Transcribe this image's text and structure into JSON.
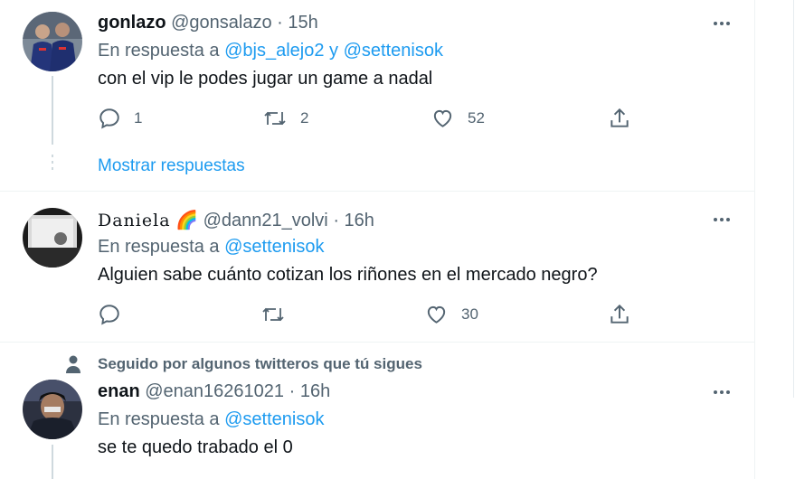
{
  "tweets": [
    {
      "display_name": "gonlazo",
      "handle": "@gonsalazo",
      "time": "15h",
      "reply_prefix": "En respuesta a",
      "mention1": "@bjs_alejo2",
      "joiner": "y",
      "mention2": "@settenisok",
      "text": "con el vip le podes jugar un game a nadal",
      "replies": "1",
      "retweets": "2",
      "likes": "52"
    },
    {
      "display_name": "Daniela",
      "emoji": "🌈",
      "handle": "@dann21_volvi",
      "time": "16h",
      "reply_prefix": "En respuesta a",
      "mention1": "@settenisok",
      "text": "Alguien sabe cuánto cotizan los riñones en el mercado negro?",
      "replies": "",
      "retweets": "",
      "likes": "30"
    },
    {
      "social_context": "Seguido por algunos twitteros que tú sigues",
      "display_name": "enan",
      "handle": "@enan16261021",
      "time": "16h",
      "reply_prefix": "En respuesta a",
      "mention1": "@settenisok",
      "text": "se te quedo trabado el 0"
    }
  ],
  "show_replies": "Mostrar respuestas",
  "colors": {
    "accent": "#1d9bf0",
    "muted": "#536471",
    "text": "#0f1419"
  },
  "icons": [
    "more-icon",
    "reply-icon",
    "retweet-icon",
    "like-icon",
    "share-icon",
    "person-icon"
  ]
}
